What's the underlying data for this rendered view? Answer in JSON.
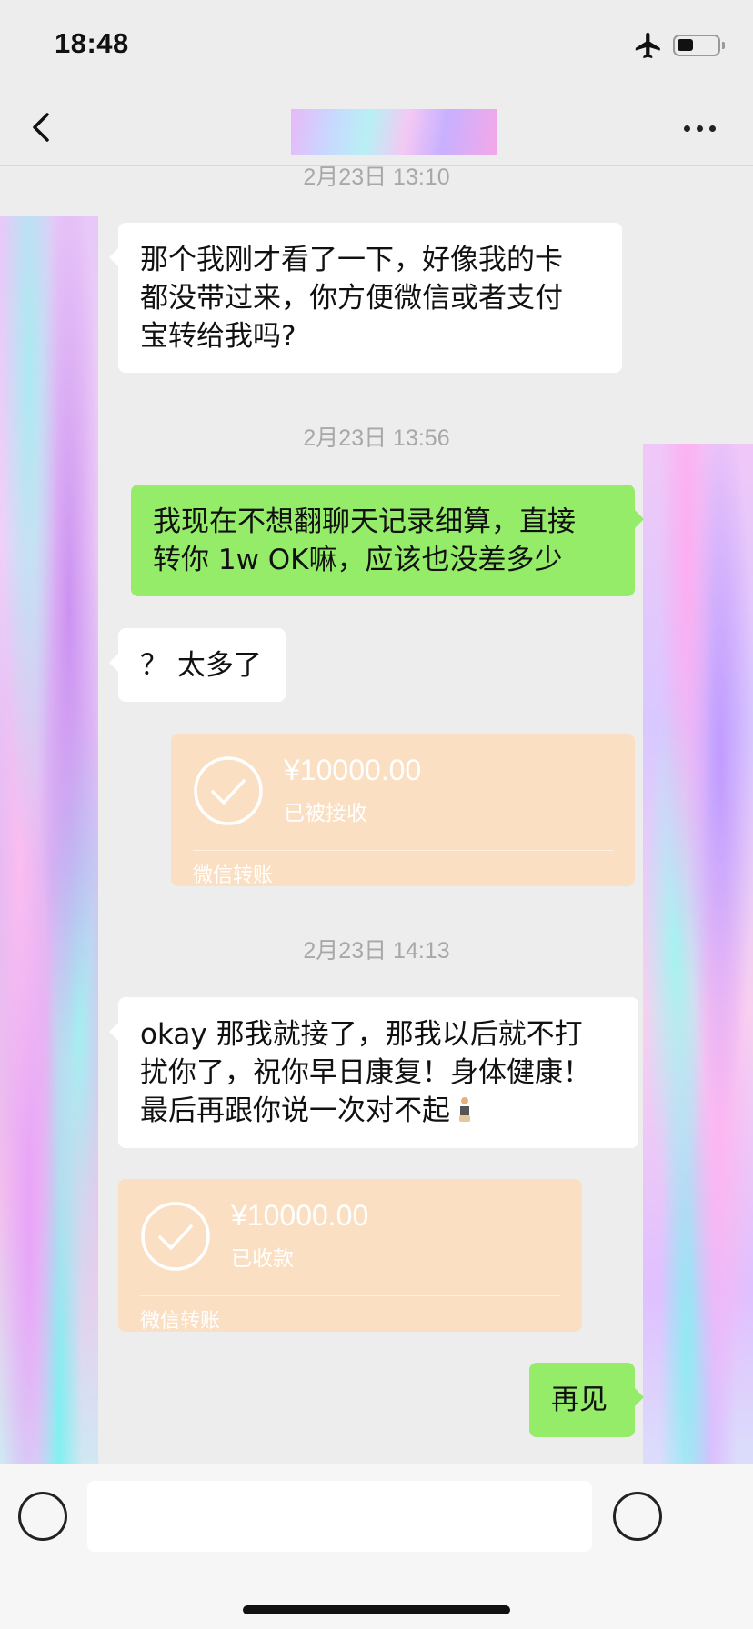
{
  "status_bar": {
    "time": "18:48",
    "battery_level": 0.4,
    "airplane_mode_icon": "airplane-icon",
    "battery_icon": "battery-icon"
  },
  "nav": {
    "back_icon": "chevron-left-icon",
    "more_icon": "ellipsis-icon"
  },
  "messages": {
    "ts1": "2月23日 13:10",
    "m1": "那个我刚才看了一下，好像我的卡\n都没带过来，你方便微信或者支付\n宝转给我吗?",
    "ts2": "2月23日 13:56",
    "m2": "我现在不想翻聊天记录细算，直接\n转你 1w OK嘛，应该也没差多少",
    "m3": "？ 太多了",
    "transfer1": {
      "amount": "¥10000.00",
      "status": "已被接收",
      "label": "微信转账"
    },
    "ts3": "2月23日 14:13",
    "m4": "okay 那我就接了，那我以后就不打\n扰你了，祝你早日康复！身体健康！\n最后再跟你说一次对不起",
    "m4_emoji": "person-standing-emoji",
    "transfer2": {
      "amount": "¥10000.00",
      "status": "已收款",
      "label": "微信转账"
    },
    "m5": "再见"
  },
  "input": {
    "value": "",
    "voice_icon": "voice-icon",
    "emoji_icon": "emoji-icon"
  },
  "colors": {
    "background": "#ededed",
    "incoming_bubble": "#ffffff",
    "outgoing_bubble": "#95ec69",
    "transfer_card": "#fbdfc3",
    "timestamp": "#a8a8a8"
  }
}
